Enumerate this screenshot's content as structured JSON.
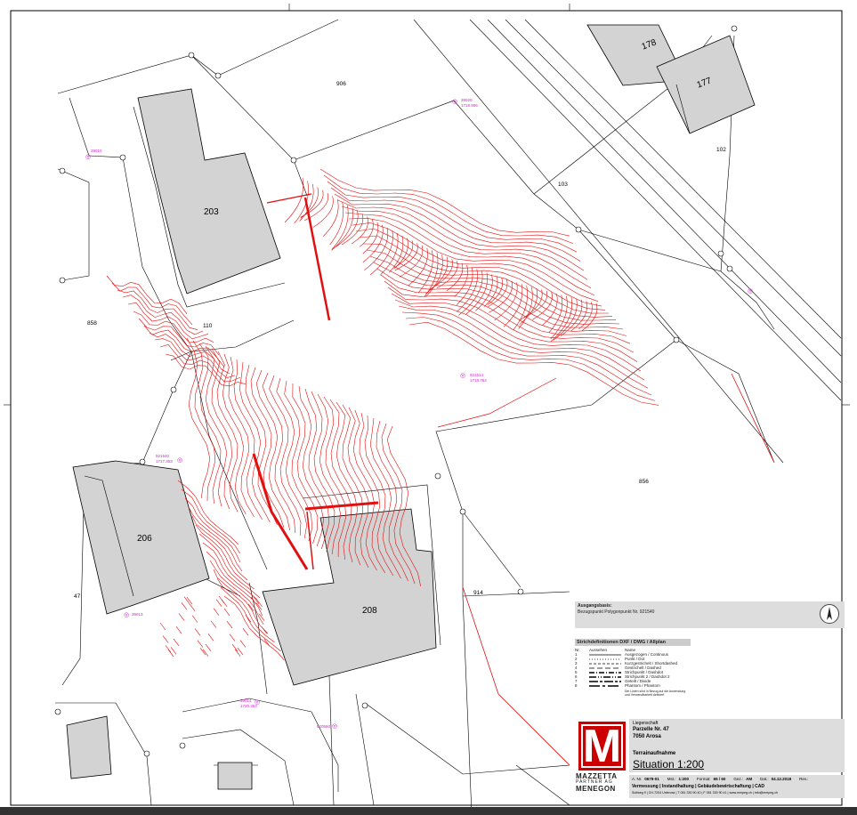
{
  "map": {
    "buildings": {
      "b178": "178",
      "b177": "177",
      "b203": "203",
      "b206": "206",
      "b208": "208"
    },
    "parcels": {
      "p906": "906",
      "p103": "103",
      "p102": "102",
      "p858": "858",
      "p110": "110",
      "p856": "856",
      "p47": "47",
      "p914": "914"
    },
    "points": {
      "pt1": "39020",
      "pt1b": "1718.906",
      "pt2": "39010",
      "pt3": "921514",
      "pt3b": "1718.764",
      "pt4": "921540",
      "pt4b": "1717.353",
      "pt5": "39013",
      "pt6": "39014",
      "pt6b": "1720.353",
      "pt7": "920560"
    },
    "north_label": "N"
  },
  "basis": {
    "title": "Ausgangsbasis:",
    "text": "Bezugspunkt Polygonpunkt Nr. 921540"
  },
  "legend": {
    "title": "Strichdefinitionen DXF / DWG / Allplan",
    "col_nr": "Nr.",
    "col_look": "Aussehen",
    "col_name": "Name",
    "rows": [
      {
        "nr": "1",
        "name": "Ausgezogen / Continous"
      },
      {
        "nr": "2",
        "name": "Punkt / Dot"
      },
      {
        "nr": "3",
        "name": "Kurzgestrichelt / Shortdashed"
      },
      {
        "nr": "4",
        "name": "Gestrichelt / Dashed"
      },
      {
        "nr": "5",
        "name": "Strichpunkt / Dashdot"
      },
      {
        "nr": "6",
        "name": "Strichpunkt 2 / Dashdot 2"
      },
      {
        "nr": "7",
        "name": "Geteilt / Divide"
      },
      {
        "nr": "8",
        "name": "Phantom / Phantom"
      }
    ],
    "note": "Die Linien sind in Bezug auf die Anwendung und Verwendbarkeit definiert"
  },
  "title_block": {
    "label_liegenschaft": "Liegenschaft",
    "parcel": "Parzelle Nr. 47",
    "place": "7050 Arosa",
    "survey": "Terrainaufnahme",
    "situation": "Situation 1:200",
    "auftrag_label": "A. Nr.",
    "auftrag": "0679-01",
    "mst_label": "Mst.:",
    "mst": "1:200",
    "format_label": "Format:",
    "format": "65 / 60",
    "gez_label": "Gez.:",
    "gez": "AM",
    "dat_label": "Dat.:",
    "dat": "04.12.2018",
    "rev_label": "Rev.:",
    "services": "Vermessung | Instandhaltung | Gebäudebewirtschaftung | CAD",
    "address": "Sulfweg 9 | CH-7204 Untervaz | T 081 330 90 40 | F 081 330 90 41 | www.mmpeg.ch | info@mmpeg.ch"
  },
  "logo": {
    "letter": "M",
    "line1": "MAZZETTA",
    "line2": "PARTNER AG",
    "line3": "MENEGON"
  },
  "colors": {
    "contour": "#e01010",
    "building": "#d3d3d3",
    "point": "#d020d0",
    "logo_red": "#cc0000"
  }
}
